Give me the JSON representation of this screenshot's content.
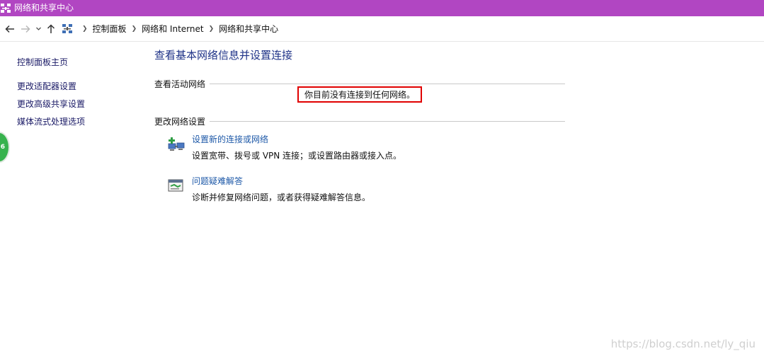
{
  "window": {
    "title": "网络和共享中心",
    "accent_color": "#b146c2"
  },
  "navigation": {
    "back_icon": "arrow-left-icon",
    "forward_icon": "arrow-right-icon",
    "recent_icon": "chevron-down-icon",
    "up_icon": "arrow-up-icon",
    "breadcrumbs": [
      "控制面板",
      "网络和 Internet",
      "网络和共享中心"
    ]
  },
  "sidebar": {
    "home": "控制面板主页",
    "links": [
      "更改适配器设置",
      "更改高级共享设置",
      "媒体流式处理选项"
    ]
  },
  "badge": {
    "text": "6",
    "color": "#37b24d"
  },
  "main": {
    "title": "查看基本网络信息并设置连接",
    "active_section": "查看活动网络",
    "no_network_message": "你目前没有连接到任何网络。",
    "settings_section": "更改网络设置",
    "tasks": [
      {
        "link": "设置新的连接或网络",
        "description": "设置宽带、拨号或 VPN 连接；或设置路由器或接入点。",
        "icon": "network-setup-icon"
      },
      {
        "link": "问题疑难解答",
        "description": "诊断并修复网络问题，或者获得疑难解答信息。",
        "icon": "troubleshoot-icon"
      }
    ],
    "highlight_color": "#e00000"
  },
  "watermark": "https://blog.csdn.net/ly_qiu"
}
